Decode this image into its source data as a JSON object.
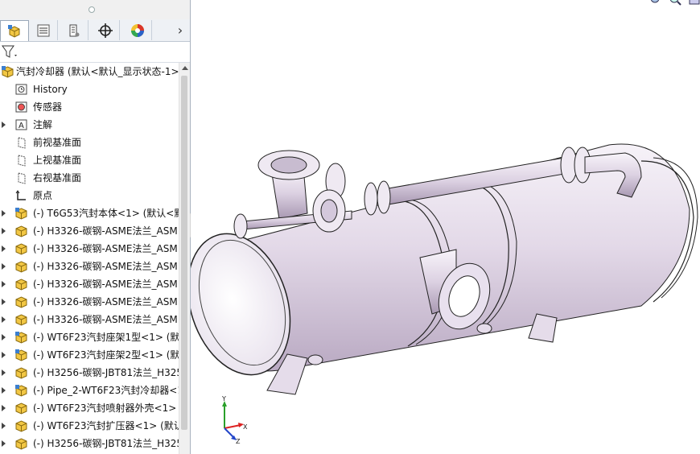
{
  "sidebar": {
    "tabs": [
      {
        "name": "featuremanager-tab",
        "icon": "feature-tree-icon",
        "active": true
      },
      {
        "name": "propertymanager-tab",
        "icon": "property-list-icon",
        "active": false
      },
      {
        "name": "configurationmanager-tab",
        "icon": "configuration-icon",
        "active": false
      },
      {
        "name": "dimxpert-tab",
        "icon": "crosshair-icon",
        "active": false
      },
      {
        "name": "display-manager-tab",
        "icon": "color-wheel-icon",
        "active": false
      }
    ],
    "more_label": "›",
    "filter_icon": "filter-icon",
    "tree": {
      "root": "汽封冷却器 (默认<默认_显示状态-1>",
      "items": [
        {
          "label": "History",
          "icon": "history-icon",
          "expandable": false
        },
        {
          "label": "传感器",
          "icon": "sensor-icon",
          "expandable": false
        },
        {
          "label": "注解",
          "icon": "annotation-icon",
          "expandable": true
        },
        {
          "label": "前视基准面",
          "icon": "plane-icon",
          "expandable": false
        },
        {
          "label": "上视基准面",
          "icon": "plane-icon",
          "expandable": false
        },
        {
          "label": "右视基准面",
          "icon": "plane-icon",
          "expandable": false
        },
        {
          "label": "原点",
          "icon": "origin-icon",
          "expandable": false
        },
        {
          "label": "(-) T6G53汽封本体<1> (默认<默",
          "icon": "assembly-icon",
          "expandable": true
        },
        {
          "label": "(-) H3326-碳钢-ASME法兰_ASM",
          "icon": "part-icon",
          "expandable": true
        },
        {
          "label": "(-) H3326-碳钢-ASME法兰_ASM",
          "icon": "part-icon",
          "expandable": true
        },
        {
          "label": "(-) H3326-碳钢-ASME法兰_ASM",
          "icon": "part-icon",
          "expandable": true
        },
        {
          "label": "(-) H3326-碳钢-ASME法兰_ASM",
          "icon": "part-icon",
          "expandable": true
        },
        {
          "label": "(-) H3326-碳钢-ASME法兰_ASM",
          "icon": "part-icon",
          "expandable": true
        },
        {
          "label": "(-) H3326-碳钢-ASME法兰_ASM",
          "icon": "part-icon",
          "expandable": true
        },
        {
          "label": "(-) WT6F23汽封座架1型<1> (默认",
          "icon": "assembly-icon",
          "expandable": true
        },
        {
          "label": "(-) WT6F23汽封座架2型<1> (默认",
          "icon": "assembly-icon",
          "expandable": true
        },
        {
          "label": "(-) H3256-碳钢-JBT81法兰_H325",
          "icon": "part-icon",
          "expandable": true
        },
        {
          "label": "(-) Pipe_2-WT6F23汽封冷却器<1",
          "icon": "assembly-icon",
          "expandable": true
        },
        {
          "label": "(-) WT6F23汽封喷射器外壳<1> (",
          "icon": "part-icon",
          "expandable": true
        },
        {
          "label": "(-) WT6F23汽封扩压器<1> (默认",
          "icon": "part-icon",
          "expandable": true
        },
        {
          "label": "(-) H3256-碳钢-JBT81法兰_H325",
          "icon": "part-icon",
          "expandable": true
        }
      ]
    }
  },
  "viewport": {
    "triad": {
      "x_label": "X",
      "y_label": "Y",
      "z_label": "Z"
    },
    "model_icon": "heat-exchanger-model"
  },
  "colors": {
    "accent_blue": "#2a6fb5",
    "part_yellow": "#e8b824",
    "model_fill": "#ece6ef",
    "model_shade": "#c9bccf"
  }
}
